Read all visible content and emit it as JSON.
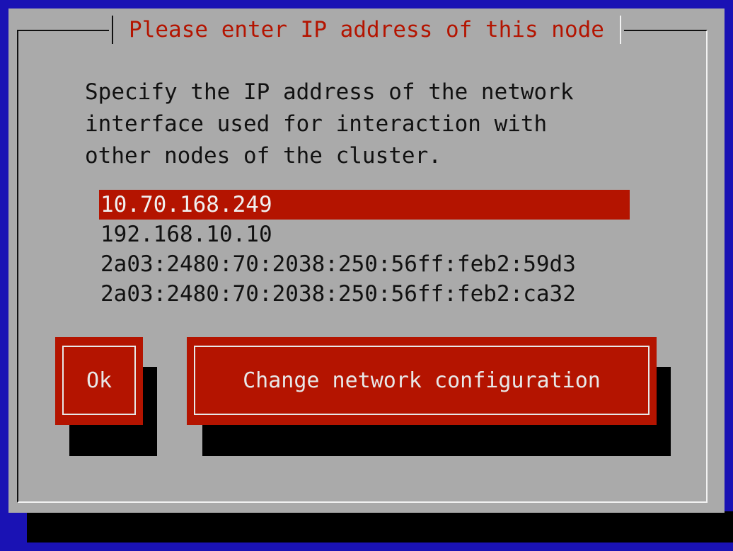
{
  "dialog": {
    "title": "Please enter IP address of this node",
    "description_lines": [
      "Specify the IP address of the network",
      "interface used for interaction with",
      "other nodes of the cluster."
    ],
    "ip_addresses": [
      {
        "value": "10.70.168.249",
        "selected": true
      },
      {
        "value": "192.168.10.10",
        "selected": false
      },
      {
        "value": "2a03:2480:70:2038:250:56ff:feb2:59d3",
        "selected": false
      },
      {
        "value": "2a03:2480:70:2038:250:56ff:feb2:ca32",
        "selected": false
      }
    ],
    "buttons": {
      "ok_label": "Ok",
      "change_network_label": "Change network configuration"
    }
  },
  "colors": {
    "screen_background": "#1a12b4",
    "dialog_background": "#aaaaaa",
    "accent_red": "#b41400",
    "shadow": "#000000"
  }
}
